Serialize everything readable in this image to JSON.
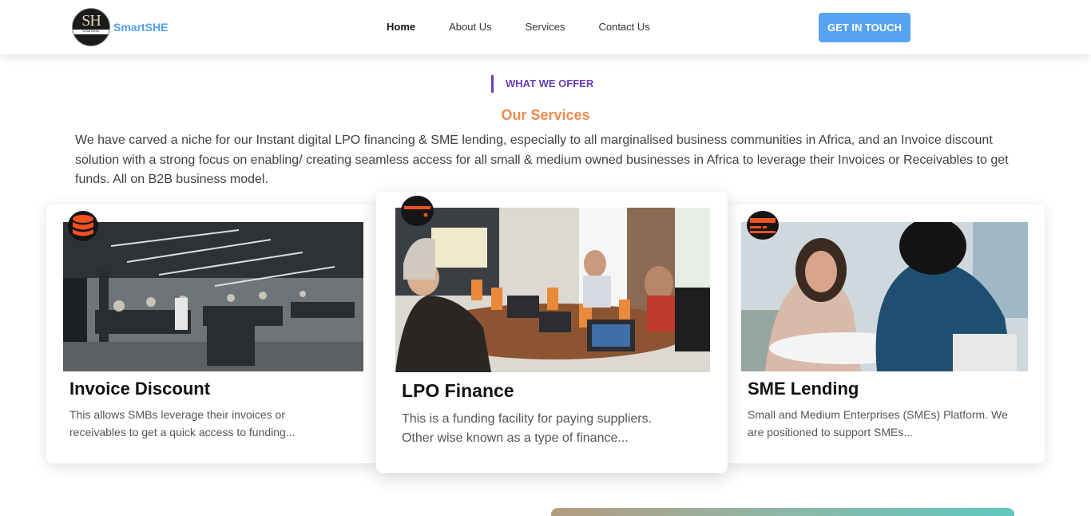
{
  "header": {
    "logo_monogram": "SH",
    "logo_subtext": "SmartSHE",
    "brand": "SmartSHE",
    "nav": [
      "Home",
      "About Us",
      "Services",
      "Contact Us"
    ],
    "active_nav": "Home",
    "cta_label": "GET IN TOUCH"
  },
  "section": {
    "eyebrow": "WHAT WE OFFER",
    "title": "Our Services",
    "description": "We have carved a niche for our Instant digital LPO financing & SME lending, especially to all marginalised business communities in Africa, and an Invoice discount solution with a strong focus on enabling/ creating seamless access for all small & medium owned businesses in Africa to leverage their Invoices or Receivables to get funds. All on B2B business model."
  },
  "cards": [
    {
      "title": "Invoice Discount",
      "text": "This allows SMBs leverage their invoices or receivables to get a quick access to funding...",
      "icon": "database-icon"
    },
    {
      "title": "LPO Finance",
      "text": "This is a funding facility for paying suppliers. Other wise known as a type of finance...",
      "icon": "credit-card-icon"
    },
    {
      "title": "SME Lending",
      "text": "Small and Medium Enterprises (SMEs) Platform. We are positioned to support SMEs...",
      "icon": "server-icon"
    }
  ],
  "colors": {
    "accent_blue": "#55a3f2",
    "brand_blue": "#4e9ff0",
    "eyebrow_purple": "#6a3fbf",
    "title_orange": "#ef8a4d",
    "icon_orange": "#f0521f"
  }
}
